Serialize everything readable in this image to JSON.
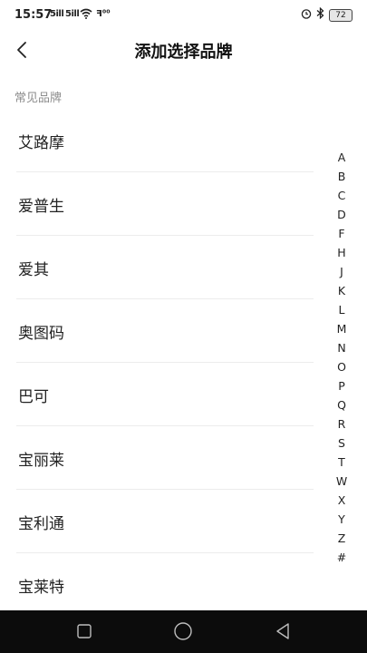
{
  "status_bar": {
    "time": "15:57",
    "signal_1": "5ill",
    "signal_2": "5ill",
    "nfc": "ꟻ⁰⁰",
    "battery": "72"
  },
  "header": {
    "title": "添加选择品牌"
  },
  "section": {
    "label": "常见品牌"
  },
  "brands": [
    "艾路摩",
    "爱普生",
    "爱其",
    "奥图码",
    "巴可",
    "宝丽莱",
    "宝利通",
    "宝莱特"
  ],
  "index_letters": [
    "A",
    "B",
    "C",
    "D",
    "F",
    "H",
    "J",
    "K",
    "L",
    "M",
    "N",
    "O",
    "P",
    "Q",
    "R",
    "S",
    "T",
    "W",
    "X",
    "Y",
    "Z",
    "#"
  ],
  "icons": {
    "back": "chevron-left-icon",
    "wifi": "wifi-icon",
    "alarm": "alarm-icon",
    "bluetooth": "bluetooth-icon",
    "nav_recent": "square-icon",
    "nav_home": "circle-icon",
    "nav_back": "triangle-back-icon"
  }
}
